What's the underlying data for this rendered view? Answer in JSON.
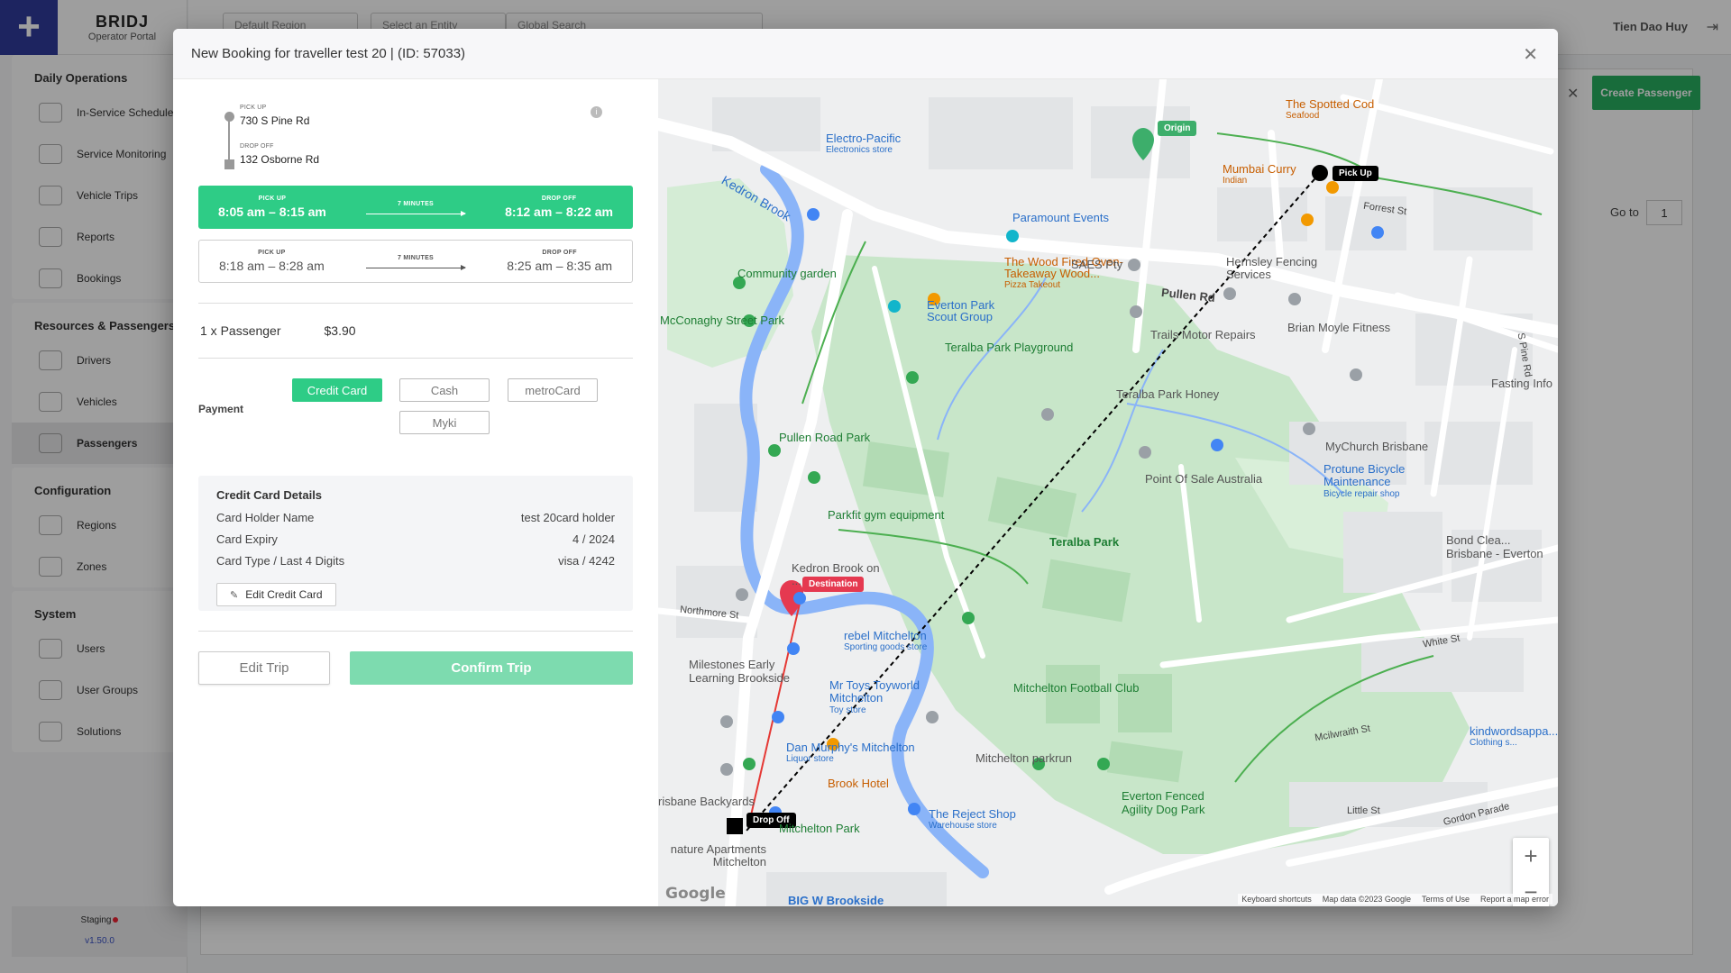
{
  "app": {
    "brand_name": "BRIDJ",
    "brand_sub": "Operator Portal",
    "user_name": "Tien Dao Huy",
    "region_select": "Default Region",
    "entity_select": "Select an Entity",
    "search_placeholder": "Global Search",
    "create_passenger": "Create Passenger",
    "goto_label": "Go to",
    "goto_value": "1",
    "env_name": "Staging",
    "env_version": "v1.50.0"
  },
  "sidebar": {
    "daily": {
      "title": "Daily Operations",
      "items": [
        "In-Service Schedules",
        "Service Monitoring",
        "Vehicle Trips",
        "Reports",
        "Bookings"
      ]
    },
    "resources": {
      "title": "Resources & Passengers",
      "items": [
        "Drivers",
        "Vehicles",
        "Passengers"
      ]
    },
    "config": {
      "title": "Configuration",
      "items": [
        "Regions",
        "Zones"
      ]
    },
    "system": {
      "title": "System",
      "items": [
        "Users",
        "User Groups",
        "Solutions"
      ]
    }
  },
  "modal": {
    "title": "New Booking for traveller test 20 | (ID: 57033)",
    "pickup_label": "PICK UP",
    "pickup_value": "730 S Pine Rd",
    "dropoff_label": "DROP OFF",
    "dropoff_value": "132 Osborne Rd",
    "slots": [
      {
        "pu_label": "PICK UP",
        "pu_time": "8:05 am – 8:15 am",
        "duration": "7 MINUTES",
        "do_label": "DROP OFF",
        "do_time": "8:12 am – 8:22 am"
      },
      {
        "pu_label": "PICK UP",
        "pu_time": "8:18 am – 8:28 am",
        "duration": "7 MINUTES",
        "do_label": "DROP OFF",
        "do_time": "8:25 am – 8:35 am"
      }
    ],
    "passenger_label": "1 x Passenger",
    "price": "$3.90",
    "payment_label": "Payment",
    "payment_options": [
      "Credit Card",
      "Cash",
      "metroCard",
      "Myki"
    ],
    "payment_selected": "Credit Card",
    "cc": {
      "title": "Credit Card Details",
      "holder_label": "Card Holder Name",
      "holder_value": "test 20card holder",
      "expiry_label": "Card Expiry",
      "expiry_value": "4 / 2024",
      "type_label": "Card Type / Last 4 Digits",
      "type_value": "visa / 4242",
      "edit_label": "Edit Credit Card"
    },
    "edit_trip": "Edit Trip",
    "confirm_trip": "Confirm Trip"
  },
  "map": {
    "tags": {
      "origin": "Origin",
      "pickup": "Pick Up",
      "destination": "Destination",
      "dropoff": "Drop Off"
    },
    "places": {
      "electro": "Electro-Pacific",
      "electro_sub": "Electronics store",
      "kedron_brook": "Kedron Brook",
      "community_garden": "Community garden",
      "mcconaghy_park": "McConaghy Street Park",
      "everton_scout": "Everton Park Scout Group",
      "oven": "The Wood Fired Oven-Takeaway Wood...",
      "oven_sub": "Pizza Takeout",
      "paramount": "Paramount Events",
      "saes": "SAES Pty",
      "pullen_rd": "Pullen Rd",
      "trails": "Trails Motor Repairs",
      "hernsley": "Hernsley Fencing Services",
      "brian": "Brian Moyle Fitness",
      "spotted_cod": "The Spotted Cod",
      "spotted_cod_sub": "Seafood",
      "mumbai": "Mumbai Curry",
      "mumbai_sub": "Indian",
      "forrest_st": "Forrest St",
      "teralba_playground": "Teralba Park Playground",
      "teralba_honey": "Teralba Park Honey",
      "fasting": "Fasting Info",
      "pullen_road_park": "Pullen Road Park",
      "parkfit": "Parkfit gym equipment",
      "teralba_park": "Teralba Park",
      "pos": "Point Of Sale Australia",
      "mychurch": "MyChurch Brisbane",
      "protune": "Protune Bicycle Maintenance",
      "protune_sub": "Bicycle repair shop",
      "bond": "Bond Clea... Brisbane - Everton",
      "kedron_on": "Kedron Brook on ...",
      "rebel": "rebel Mitchelton",
      "rebel_sub": "Sporting goods store",
      "milestones": "Milestones Early Learning Brookside",
      "mrtoys": "Mr Toys Toyworld Mitchelton",
      "mrtoys_sub": "Toy store",
      "football": "Mitchelton Football Club",
      "danmurphy": "Dan Murphy's Mitchelton",
      "danmurphy_sub": "Liquor store",
      "parkrun": "Mitchelton parkrun",
      "brook_hotel": "Brook Hotel",
      "reject": "The Reject Shop",
      "reject_sub": "Warehouse store",
      "everton_fenced": "Everton Fenced Agility Dog Park",
      "mitchelton_park": "Mitchelton Park",
      "backyards": "risbane Backyards",
      "signature": "nature Apartments Mitchelton",
      "bigw": "BIG W Brookside",
      "kindwords": "kindwordsappa...",
      "kindwords_sub": "Clothing s...",
      "white_st": "White St",
      "mcilwraith": "Mcilwraith St",
      "gordon_parade": "Gordon Parade",
      "little_st": "Little St",
      "northmore": "Northmore St",
      "s_pine": "S Pine Rd"
    },
    "attribution": [
      "Keyboard shortcuts",
      "Map data ©2023 Google",
      "Terms of Use",
      "Report a map error"
    ],
    "google": "Google"
  }
}
